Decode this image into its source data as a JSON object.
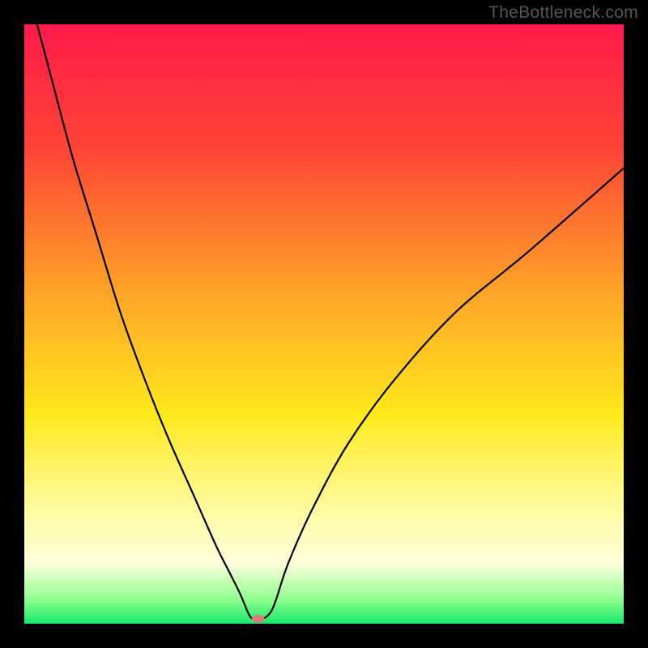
{
  "attribution": "TheBottleneck.com",
  "chart_data": {
    "type": "line",
    "title": "",
    "xlabel": "",
    "ylabel": "",
    "xlim": [
      0,
      100
    ],
    "ylim": [
      0,
      100
    ],
    "gradient_stops": [
      {
        "offset": 0,
        "color": "#ff1a4b"
      },
      {
        "offset": 20,
        "color": "#ff4236"
      },
      {
        "offset": 45,
        "color": "#ffa528"
      },
      {
        "offset": 65,
        "color": "#ffe81c"
      },
      {
        "offset": 80,
        "color": "#fffb9a"
      },
      {
        "offset": 90,
        "color": "#fdffdb"
      },
      {
        "offset": 96,
        "color": "#8eff8e"
      },
      {
        "offset": 100,
        "color": "#17e86c"
      }
    ],
    "series": [
      {
        "name": "bottleneck-curve",
        "x": [
          0,
          4,
          8,
          12,
          16,
          20,
          24,
          28,
          32,
          34,
          36,
          37.5,
          38.5,
          39.5,
          41,
          42,
          44,
          48,
          54,
          62,
          72,
          84,
          100
        ],
        "y": [
          108,
          93,
          78,
          65,
          52,
          41,
          31,
          22,
          13,
          9,
          5,
          1.5,
          0.6,
          0.6,
          1.8,
          4,
          10,
          19,
          30,
          41,
          52,
          62,
          76
        ]
      }
    ],
    "marker": {
      "x": 39,
      "y": 0.8,
      "color": "#d87a7a",
      "rx": 8,
      "ry": 5
    }
  }
}
